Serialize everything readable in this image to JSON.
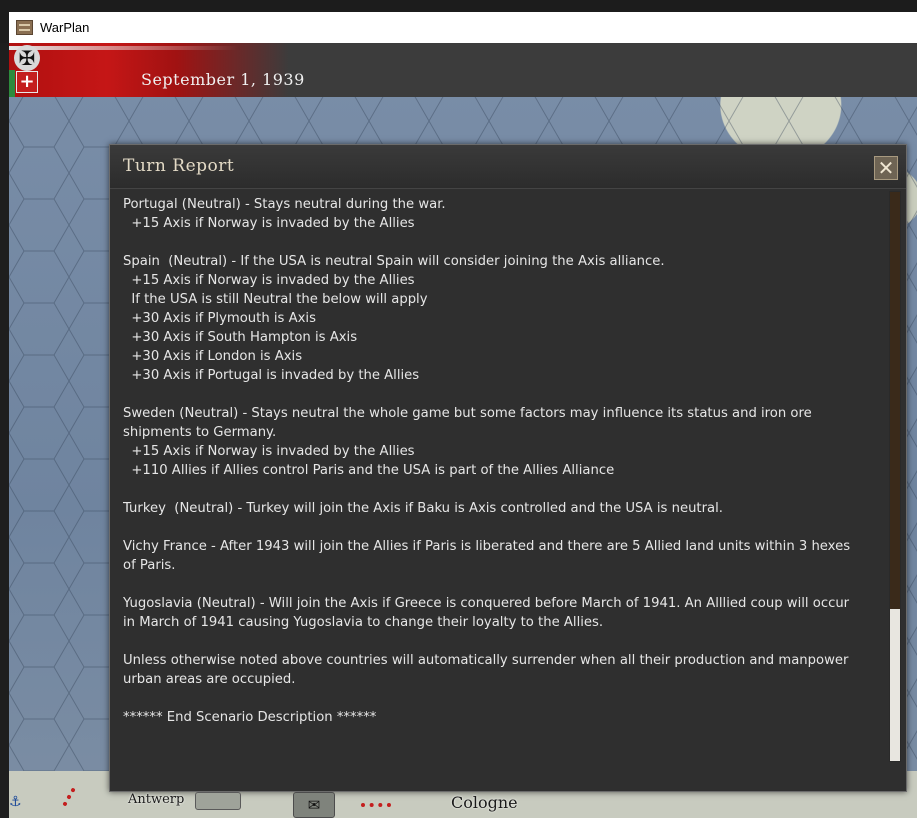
{
  "window": {
    "title": "WarPlan"
  },
  "header": {
    "date": "September 1, 1939"
  },
  "dialog": {
    "title": "Turn Report",
    "close_label": "✕",
    "paragraphs": [
      [
        "Portugal (Neutral) - Stays neutral during the war.",
        "  +15 Axis if Norway is invaded by the Allies"
      ],
      [
        "Spain  (Neutral) - If the USA is neutral Spain will consider joining the Axis alliance.",
        "  +15 Axis if Norway is invaded by the Allies",
        "  If the USA is still Neutral the below will apply",
        "  +30 Axis if Plymouth is Axis",
        "  +30 Axis if South Hampton is Axis",
        "  +30 Axis if London is Axis",
        "  +30 Axis if Portugal is invaded by the Allies"
      ],
      [
        "Sweden (Neutral) - Stays neutral the whole game but some factors may influence its status and iron ore",
        "shipments to Germany.",
        "  +15 Axis if Norway is invaded by the Allies",
        "  +110 Allies if Allies control Paris and the USA is part of the Allies Alliance"
      ],
      [
        "Turkey  (Neutral) - Turkey will join the Axis if Baku is Axis controlled and the USA is neutral."
      ],
      [
        "Vichy France - After 1943 will join the Allies if Paris is liberated and there are 5 Allied land units within 3 hexes",
        "of Paris."
      ],
      [
        "Yugoslavia (Neutral) - Will join the Axis if Greece is conquered before March of 1941. An Alllied coup will occur",
        "in March of 1941 causing Yugoslavia to change their loyalty to the Allies."
      ],
      [
        "Unless otherwise noted above countries will automatically surrender when all their production and manpower",
        "urban areas are occupied."
      ],
      [
        "****** End Scenario Description ******"
      ]
    ]
  },
  "map": {
    "cities": [
      "Antwerp",
      "Cologne"
    ],
    "icons": [
      "anchor-icon",
      "envelope-icon",
      "iron-cross-icon",
      "red-cross-flag-icon"
    ]
  }
}
